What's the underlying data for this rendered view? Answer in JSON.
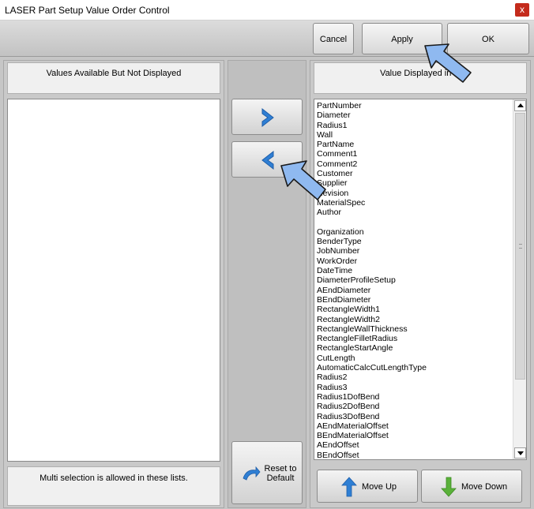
{
  "window": {
    "title": "LASER Part Setup Value Order Control",
    "close_label": "x"
  },
  "toolbar": {
    "cancel_label": "Cancel",
    "apply_label": "Apply",
    "ok_label": "OK"
  },
  "left_panel": {
    "header": "Values Available But Not Displayed",
    "footer": "Multi selection is allowed in these lists."
  },
  "right_panel": {
    "header": "Value Displayed in O",
    "items": [
      "PartNumber",
      "Diameter",
      "Radius1",
      "Wall",
      "PartName",
      "Comment1",
      "Comment2",
      "Customer",
      "Supplier",
      "Revision",
      "MaterialSpec",
      "Author",
      "",
      "Organization",
      "BenderType",
      "JobNumber",
      "WorkOrder",
      "DateTime",
      "DiameterProfileSetup",
      "AEndDiameter",
      "BEndDiameter",
      "RectangleWidth1",
      "RectangleWidth2",
      "RectangleWallThickness",
      "RectangleFilletRadius",
      "RectangleStartAngle",
      "CutLength",
      "AutomaticCalcCutLengthType",
      "Radius2",
      "Radius3",
      "Radius1DofBend",
      "Radius2DofBend",
      "Radius3DofBend",
      "AEndMaterialOffset",
      "BEndMaterialOffset",
      "AEndOffset",
      "BEndOffset"
    ],
    "move_up_label": "Move Up",
    "move_down_label": "Move Down"
  },
  "middle": {
    "move_right_icon": "chevron-right-icon",
    "move_left_icon": "chevron-left-icon",
    "reset_label": "Reset to Default"
  },
  "colors": {
    "accent_blue": "#2f7fd4",
    "pointer_blue": "#8fb9f0",
    "close_red": "#c42b1c",
    "down_green": "#5ab13a"
  }
}
